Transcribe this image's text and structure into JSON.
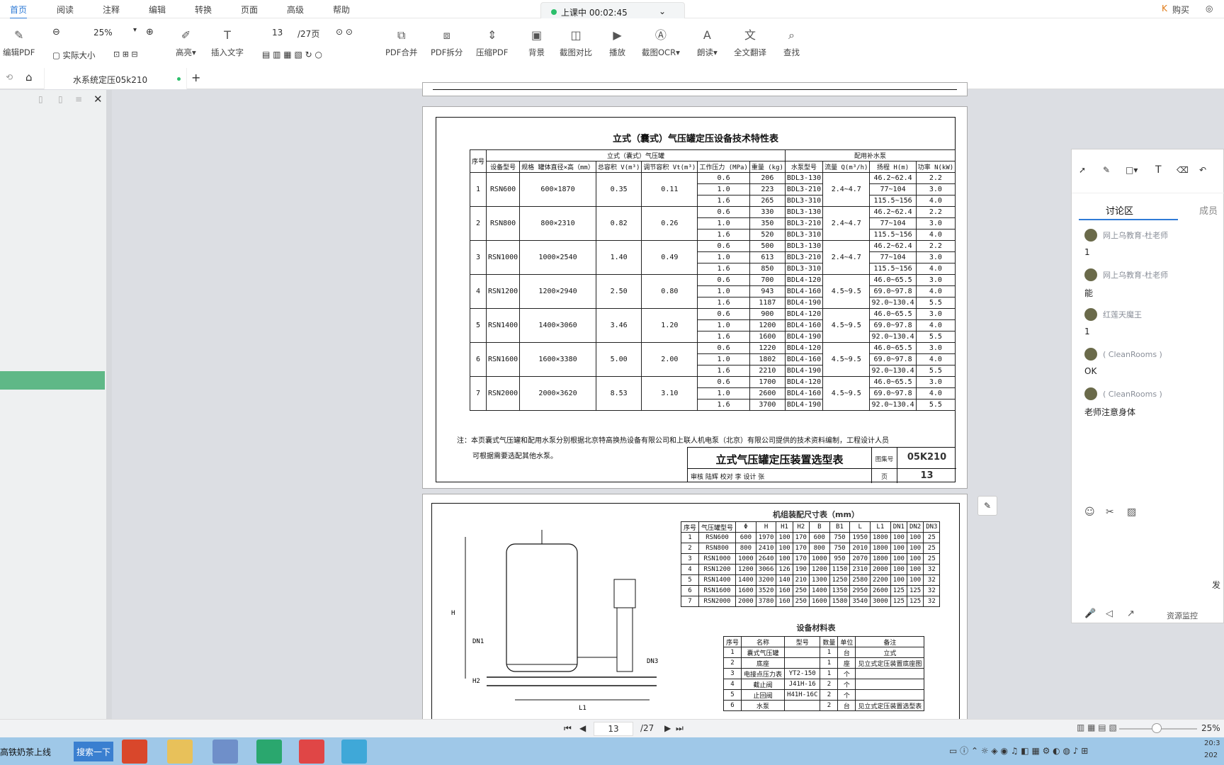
{
  "menu": {
    "items": [
      "首页",
      "阅读",
      "注释",
      "编辑",
      "转换",
      "页面",
      "高级",
      "帮助"
    ],
    "active": "首页",
    "right_buy": "购买"
  },
  "class_timer": "上课中 00:02:45",
  "toolbar": {
    "edit_pdf": "编辑PDF",
    "zoom": "25%",
    "actual_size": "实际大小",
    "highlight": "高亮",
    "insert_text": "插入文字",
    "page_num": "13",
    "page_total": "/27页",
    "pdf_merge": "PDF合并",
    "pdf_split": "PDF拆分",
    "pdf_compress": "压缩PDF",
    "background": "背景",
    "screenshot_compare": "截图对比",
    "play": "播放",
    "screenshot_ocr": "截图OCR",
    "read_aloud": "朗读",
    "full_translate": "全文翻译",
    "search": "查找"
  },
  "tab": {
    "title": "水系统定压05k210"
  },
  "doc": {
    "table_title": "立式（囊式）气压罐定压设备技术特性表",
    "group_tank": "立式（囊式）气压罐",
    "group_pump": "配用补水泵",
    "headers": [
      "序号",
      "设备型号",
      "规格 罐体直径×高（mm）",
      "总容积 V(m³)",
      "调节容积 Vt(m³)",
      "工作压力 (MPa)",
      "重量 (kg)",
      "水泵型号",
      "流量 Q(m³/h)",
      "扬程 H(m)",
      "功率 N(kW)"
    ],
    "rows": [
      {
        "no": "1",
        "model": "RSN600",
        "spec": "600×1870",
        "v": "0.35",
        "vt": "0.11",
        "flow": "2.4~4.7",
        "sub": [
          [
            "0.6",
            "206",
            "BDL3-130",
            "46.2~62.4",
            "2.2"
          ],
          [
            "1.0",
            "223",
            "BDL3-210",
            "77~104",
            "3.0"
          ],
          [
            "1.6",
            "265",
            "BDL3-310",
            "115.5~156",
            "4.0"
          ]
        ]
      },
      {
        "no": "2",
        "model": "RSN800",
        "spec": "800×2310",
        "v": "0.82",
        "vt": "0.26",
        "flow": "2.4~4.7",
        "sub": [
          [
            "0.6",
            "330",
            "BDL3-130",
            "46.2~62.4",
            "2.2"
          ],
          [
            "1.0",
            "350",
            "BDL3-210",
            "77~104",
            "3.0"
          ],
          [
            "1.6",
            "520",
            "BDL3-310",
            "115.5~156",
            "4.0"
          ]
        ]
      },
      {
        "no": "3",
        "model": "RSN1000",
        "spec": "1000×2540",
        "v": "1.40",
        "vt": "0.49",
        "flow": "2.4~4.7",
        "sub": [
          [
            "0.6",
            "500",
            "BDL3-130",
            "46.2~62.4",
            "2.2"
          ],
          [
            "1.0",
            "613",
            "BDL3-210",
            "77~104",
            "3.0"
          ],
          [
            "1.6",
            "850",
            "BDL3-310",
            "115.5~156",
            "4.0"
          ]
        ]
      },
      {
        "no": "4",
        "model": "RSN1200",
        "spec": "1200×2940",
        "v": "2.50",
        "vt": "0.80",
        "flow": "4.5~9.5",
        "sub": [
          [
            "0.6",
            "700",
            "BDL4-120",
            "46.0~65.5",
            "3.0"
          ],
          [
            "1.0",
            "943",
            "BDL4-160",
            "69.0~97.8",
            "4.0"
          ],
          [
            "1.6",
            "1187",
            "BDL4-190",
            "92.0~130.4",
            "5.5"
          ]
        ]
      },
      {
        "no": "5",
        "model": "RSN1400",
        "spec": "1400×3060",
        "v": "3.46",
        "vt": "1.20",
        "flow": "4.5~9.5",
        "sub": [
          [
            "0.6",
            "900",
            "BDL4-120",
            "46.0~65.5",
            "3.0"
          ],
          [
            "1.0",
            "1200",
            "BDL4-160",
            "69.0~97.8",
            "4.0"
          ],
          [
            "1.6",
            "1600",
            "BDL4-190",
            "92.0~130.4",
            "5.5"
          ]
        ]
      },
      {
        "no": "6",
        "model": "RSN1600",
        "spec": "1600×3380",
        "v": "5.00",
        "vt": "2.00",
        "flow": "4.5~9.5",
        "sub": [
          [
            "0.6",
            "1220",
            "BDL4-120",
            "46.0~65.5",
            "3.0"
          ],
          [
            "1.0",
            "1802",
            "BDL4-160",
            "69.0~97.8",
            "4.0"
          ],
          [
            "1.6",
            "2210",
            "BDL4-190",
            "92.0~130.4",
            "5.5"
          ]
        ]
      },
      {
        "no": "7",
        "model": "RSN2000",
        "spec": "2000×3620",
        "v": "8.53",
        "vt": "3.10",
        "flow": "4.5~9.5",
        "sub": [
          [
            "0.6",
            "1700",
            "BDL4-120",
            "46.0~65.5",
            "3.0"
          ],
          [
            "1.0",
            "2600",
            "BDL4-160",
            "69.0~97.8",
            "4.0"
          ],
          [
            "1.6",
            "3700",
            "BDL4-190",
            "92.0~130.4",
            "5.5"
          ]
        ]
      }
    ],
    "note": "注：本页囊式气压罐和配用水泵分别根据北京特高换热设备有限公司和上联人机电泵（北京）有限公司提供的技术资料编制，工程设计人员",
    "note2": "可根据需要选配其他水泵。",
    "title_block": "立式气压罐定压装置选型表",
    "atlas_label": "图集号",
    "atlas_no": "05K210",
    "page_label": "页",
    "page_no": "13",
    "sign_row": "审核 陆辉 校对 李 设计 张",
    "assembly_title": "机组装配尺寸表（mm）",
    "assembly_headers": [
      "序号",
      "气压罐型号",
      "Φ",
      "H",
      "H1",
      "H2",
      "B",
      "B1",
      "L",
      "L1",
      "DN1",
      "DN2",
      "DN3"
    ],
    "assembly_rows": [
      [
        "1",
        "RSN600",
        "600",
        "1970",
        "100",
        "170",
        "600",
        "750",
        "1950",
        "1800",
        "100",
        "100",
        "25"
      ],
      [
        "2",
        "RSN800",
        "800",
        "2410",
        "100",
        "170",
        "800",
        "750",
        "2010",
        "1800",
        "100",
        "100",
        "25"
      ],
      [
        "3",
        "RSN1000",
        "1000",
        "2640",
        "100",
        "170",
        "1000",
        "950",
        "2070",
        "1800",
        "100",
        "100",
        "25"
      ],
      [
        "4",
        "RSN1200",
        "1200",
        "3066",
        "126",
        "190",
        "1200",
        "1150",
        "2310",
        "2000",
        "100",
        "100",
        "32"
      ],
      [
        "5",
        "RSN1400",
        "1400",
        "3200",
        "140",
        "210",
        "1300",
        "1250",
        "2580",
        "2200",
        "100",
        "100",
        "32"
      ],
      [
        "6",
        "RSN1600",
        "1600",
        "3520",
        "160",
        "250",
        "1400",
        "1350",
        "2950",
        "2600",
        "125",
        "125",
        "32"
      ],
      [
        "7",
        "RSN2000",
        "2000",
        "3780",
        "160",
        "250",
        "1600",
        "1580",
        "3540",
        "3000",
        "125",
        "125",
        "32"
      ]
    ],
    "material_title": "设备材料表",
    "material_headers": [
      "序号",
      "名称",
      "型号",
      "数量",
      "单位",
      "备注"
    ],
    "material_rows": [
      [
        "1",
        "囊式气压罐",
        "",
        "1",
        "台",
        "立式"
      ],
      [
        "2",
        "底座",
        "",
        "1",
        "座",
        "见立式定压装置底座图"
      ],
      [
        "3",
        "电接点压力表",
        "YT2-150",
        "1",
        "个",
        ""
      ],
      [
        "4",
        "截止阀",
        "J41H-16",
        "2",
        "个",
        ""
      ],
      [
        "5",
        "止回阀",
        "H41H-16C",
        "2",
        "个",
        ""
      ],
      [
        "6",
        "水泵",
        "",
        "2",
        "台",
        "见立式定压装置选型表"
      ]
    ],
    "drawing_labels": {
      "h": "H",
      "dn1": "DN1",
      "dn3": "DN3",
      "h2": "H2",
      "l1": "L1"
    }
  },
  "panel": {
    "tab_discuss": "讨论区",
    "tab_members": "成员",
    "messages": [
      {
        "name": "网上乌教育-杜老师",
        "text": "1"
      },
      {
        "name": "网上乌教育-杜老师",
        "text": "能"
      },
      {
        "name": "红莲天魔王",
        "text": "1"
      },
      {
        "name": "( CleanRooms )",
        "text": "OK"
      },
      {
        "name": "( CleanRooms )",
        "text": "老师注意身体"
      }
    ],
    "send": "发",
    "resource_monitor": "资源监控"
  },
  "status": {
    "page": "13",
    "total": "/27",
    "zoom": "25%"
  },
  "taskbar": {
    "news": "高铁奶茶上线",
    "search_btn": "搜索一下",
    "time": "20:3",
    "date": "202"
  }
}
